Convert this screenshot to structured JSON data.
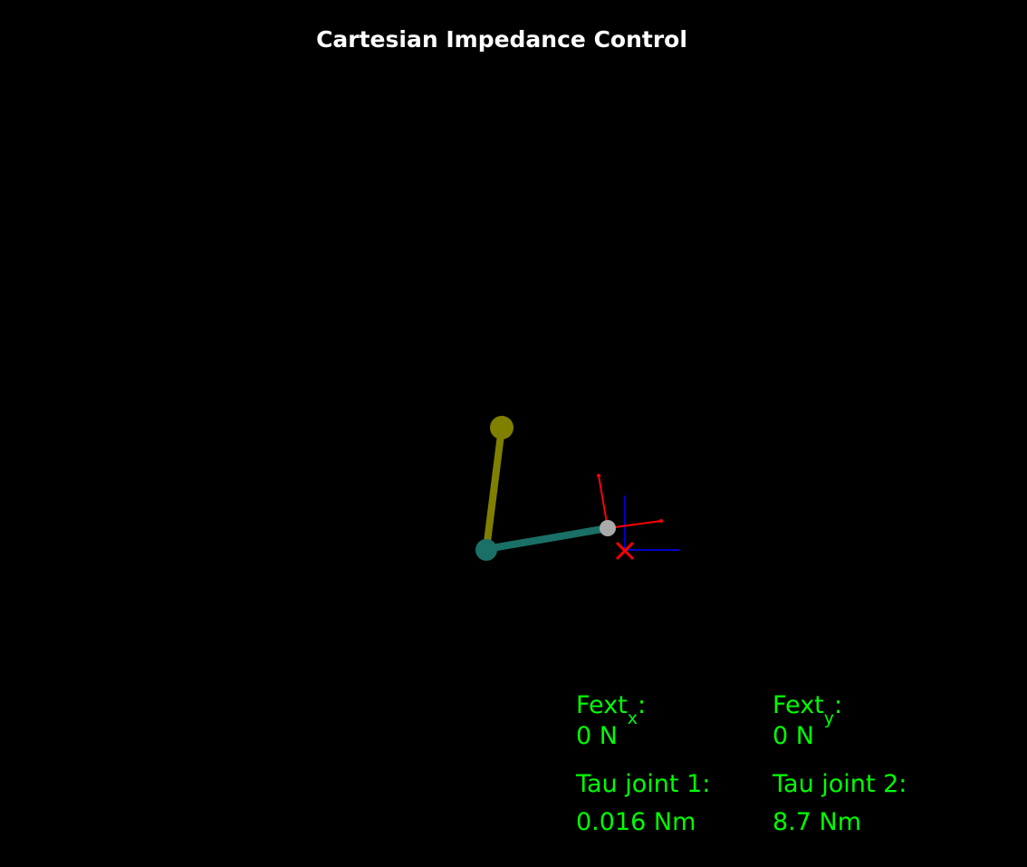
{
  "title": "Cartesian Impedance Control",
  "colors": {
    "background": "#000000",
    "title": "#ffffff",
    "readout": "#00ff00",
    "link1": "#808000",
    "link2": "#1a7066",
    "end_effector": "#aaaaaa",
    "target_marker": "#ff0000",
    "target_frame": "#0000cc",
    "ee_frame": "#ff0000"
  },
  "icons": {
    "target": "x-cross-icon"
  },
  "readouts": {
    "fext_x": {
      "label_base": "Fext",
      "label_sub": "x",
      "label_suffix": ":",
      "value": "0 N"
    },
    "fext_y": {
      "label_base": "Fext",
      "label_sub": "y",
      "label_suffix": ":",
      "value": "0 N"
    },
    "tau_joint_1": {
      "label": "Tau joint 1:",
      "value": "0.016 Nm"
    },
    "tau_joint_2": {
      "label": "Tau joint 2:",
      "value": "8.7 Nm"
    }
  }
}
